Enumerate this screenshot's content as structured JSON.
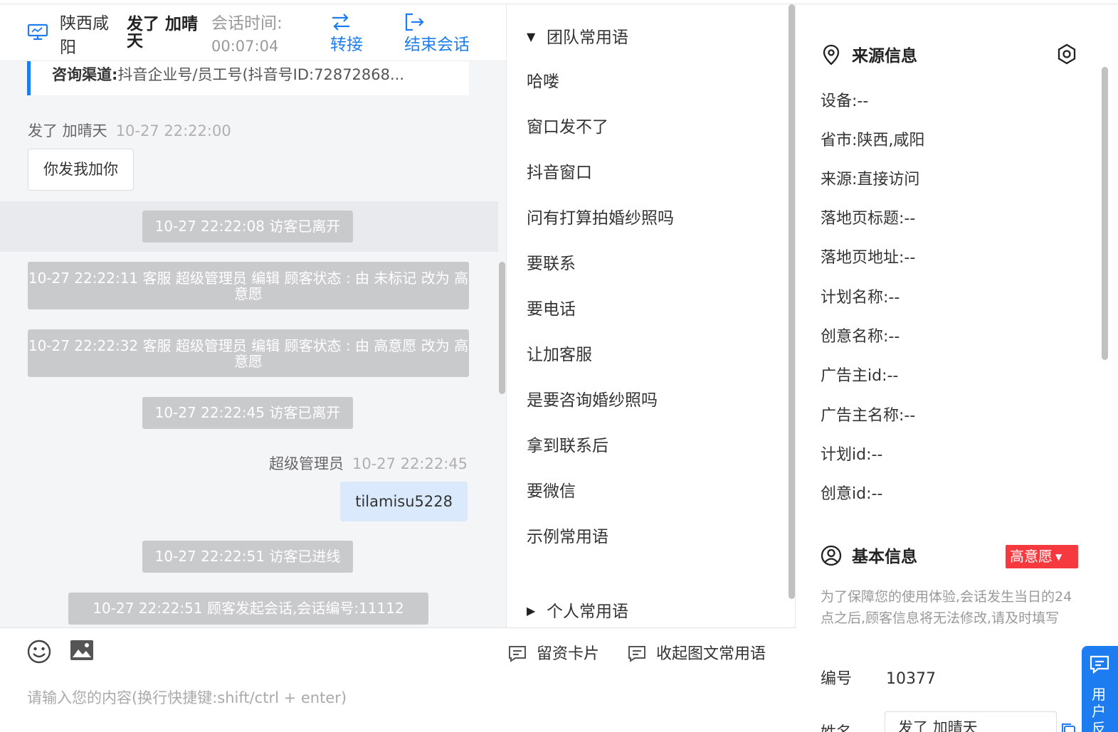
{
  "colors": {
    "accent": "#1c7cf0",
    "status_red": "#f5393f",
    "system_msg_bg": "#c9cacc",
    "agent_bubble": "#dbe9fd"
  },
  "header": {
    "location": "陕西咸阳",
    "visitor_name": "发了 加晴天",
    "session_time_label": "会话时间:",
    "session_time_value": "00:07:04",
    "transfer_label": "转接",
    "end_session_label": "结束会话",
    "icons": {
      "device": "monitor-icon",
      "transfer": "transfer-arrows-icon",
      "end": "exit-icon"
    }
  },
  "channel": {
    "label": "咨询渠道:",
    "value": "抖音企业号/员工号(抖音号ID:72872868..."
  },
  "messages": {
    "visitor_meta_name": "发了 加晴天",
    "visitor_meta_time": "10-27 22:22:00",
    "visitor_text": "你发我加你",
    "sys1": "10-27 22:22:08 访客已离开",
    "sys2": "10-27 22:22:11 客服 超级管理员 编辑 顾客状态 : 由 未标记 改为 高意愿",
    "sys3": "10-27 22:22:32 客服 超级管理员 编辑 顾客状态 : 由 高意愿 改为 高意愿",
    "sys4": "10-27 22:22:45 访客已离开",
    "agent_meta_name": "超级管理员",
    "agent_meta_time": "10-27 22:22:45",
    "agent_text": "tilamisu5228",
    "sys5": "10-27 22:22:51 访客已进线",
    "sys6": "10-27 22:22:51 顾客发起会话,会话编号:11112"
  },
  "input": {
    "placeholder": "请输入您的内容(换行快捷键:shift/ctrl + enter)",
    "card_label": "留资卡片",
    "collapse_label": "收起图文常用语",
    "icons": {
      "emoji": "emoji-icon",
      "image": "image-icon",
      "card": "message-card-icon"
    }
  },
  "phrases": {
    "team_group": "团队常用语",
    "personal_group": "个人常用语",
    "items": [
      "哈喽",
      "窗口发不了",
      "抖音窗口",
      "问有打算拍婚纱照吗",
      "要联系",
      "要电话",
      "让加客服",
      "是要咨询婚纱照吗",
      "拿到联系后",
      "要微信",
      "示例常用语"
    ]
  },
  "source_info": {
    "title": "来源信息",
    "rows": [
      "设备:--",
      "省市:陕西,咸阳",
      "来源:直接访问",
      "落地页标题:--",
      "落地页地址:--",
      "计划名称:--",
      "创意名称:--",
      "广告主id:--",
      "广告主名称:--",
      "计划id:--",
      "创意id:--"
    ]
  },
  "basic_info": {
    "title": "基本信息",
    "status": "高意愿",
    "notice": "为了保障您的使用体验,会话发生当日的24点之后,顾客信息将无法修改,请及时填写",
    "code_label": "编号",
    "code_value": "10377",
    "name_label": "姓名",
    "name_value": "发了 加晴天"
  },
  "feedback": {
    "label": "用户反馈"
  }
}
